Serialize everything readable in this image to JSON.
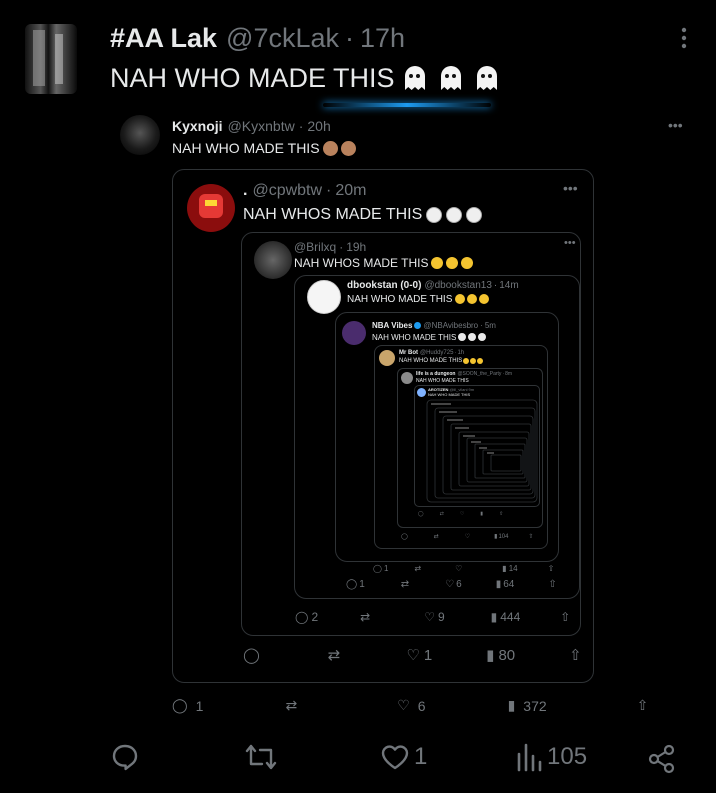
{
  "main": {
    "display_name": "#AA Lak",
    "handle": "@7ckLak",
    "sep": "·",
    "time": "17h",
    "text": "NAH WHO MADE THIS",
    "replies": "",
    "retweets": "",
    "likes": "1",
    "views": "105",
    "more_icon": "more-vertical-icon"
  },
  "t1": {
    "display_name": "Kyxnoji",
    "handle": "@Kyxnbtw",
    "sep": "·",
    "time": "20h",
    "text": "NAH WHO MADE THIS",
    "replies": "1",
    "retweets": "",
    "likes": "6",
    "views": "372"
  },
  "t2": {
    "display_name": ".",
    "handle": "@cpwbtw",
    "sep": "·",
    "time": "20m",
    "text": "NAH WHOS MADE THIS",
    "replies": "",
    "retweets": "",
    "likes": "1",
    "views": "80"
  },
  "t3": {
    "display_name": "",
    "handle": "@Brilxq",
    "sep": "·",
    "time": "19h",
    "text": "NAH WHOS MADE THIS",
    "replies": "2",
    "retweets": "",
    "likes": "9",
    "views": "444"
  },
  "t4": {
    "display_name": "dbookstan (0-0)",
    "handle": "@dbookstan13",
    "sep": "·",
    "time": "14m",
    "text": "NAH WHO MADE THIS",
    "replies": "1",
    "retweets": "",
    "likes": "6",
    "views": "64"
  },
  "t5": {
    "display_name": "NBA Vibes",
    "handle": "@NBAvibesbro",
    "sep": "·",
    "time": "5m",
    "text": "NAH WHO MADE THIS",
    "replies": "1",
    "retweets": "",
    "likes": "",
    "views": "14"
  },
  "t6": {
    "display_name": "Mr Bot",
    "handle": "@Huddy725",
    "sep": "·",
    "time": "1h",
    "text": "NAH WHO MADE THIS",
    "views": "104"
  },
  "t7": {
    "display_name": "life is a dungeon",
    "handle": "@SOON_the_Party",
    "sep": "·",
    "time": "8m",
    "text": "NAH WHO MADE THIS"
  },
  "t8": {
    "display_name": "AROTIZEN",
    "handle": "@lil_vilani",
    "time": "9m",
    "text": "NAH WHO MADE THIS"
  },
  "colors": {
    "background": "#000000",
    "text": "#e7e9ea",
    "muted": "#71767b",
    "border": "#2f3336",
    "accent": "#1d9bf0"
  }
}
